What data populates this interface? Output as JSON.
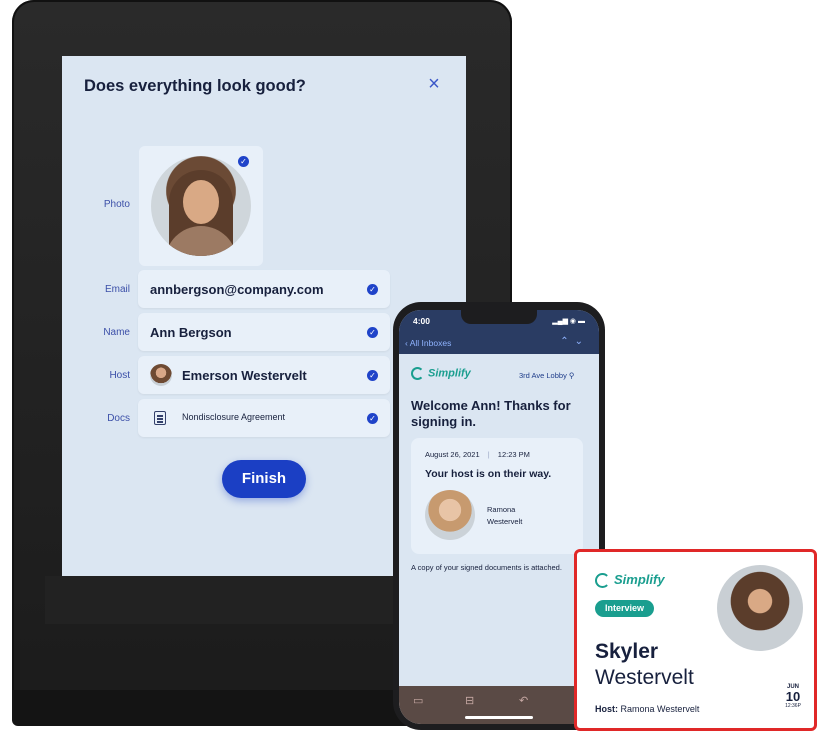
{
  "kiosk": {
    "title": "Does everything look good?",
    "close_symbol": "×",
    "rows": {
      "photo_label": "Photo",
      "email_label": "Email",
      "email_value": "annbergson@company.com",
      "name_label": "Name",
      "name_value": "Ann Bergson",
      "host_label": "Host",
      "host_value": "Emerson Westervelt",
      "docs_label": "Docs",
      "docs_value": "Nondisclosure Agreement"
    },
    "check_symbol": "✓",
    "finish_label": "Finish"
  },
  "phone": {
    "time": "4:00",
    "signal": "▂▄▆ ◉ ▬",
    "back_label": "All Inboxes",
    "arrows": "⌃⌄",
    "logo": "Simplify",
    "lobby": "3rd Ave Lobby",
    "welcome": "Welcome Ann! Thanks for signing in.",
    "date": "August 26, 2021",
    "time_sent": "12:23 PM",
    "host_message": "Your host is on their way.",
    "host_first": "Ramona",
    "host_last": "Westervelt",
    "note": "A copy of your signed documents is attached."
  },
  "badge": {
    "logo": "Simplify",
    "tag": "Interview",
    "first_name": "Skyler",
    "last_name": "Westervelt",
    "host_label": "Host:",
    "host_name": "Ramona Westervelt",
    "month": "JUN",
    "day": "10",
    "time": "12:36P"
  },
  "colors": {
    "accent_blue": "#1b3fc4",
    "teal": "#1a9e8f",
    "badge_border": "#e02828",
    "screen_bg": "#dbe6f2"
  },
  "icons": [
    "close-icon",
    "check-icon",
    "document-icon",
    "location-pin-icon",
    "archive-icon",
    "folder-icon",
    "reply-icon"
  ]
}
